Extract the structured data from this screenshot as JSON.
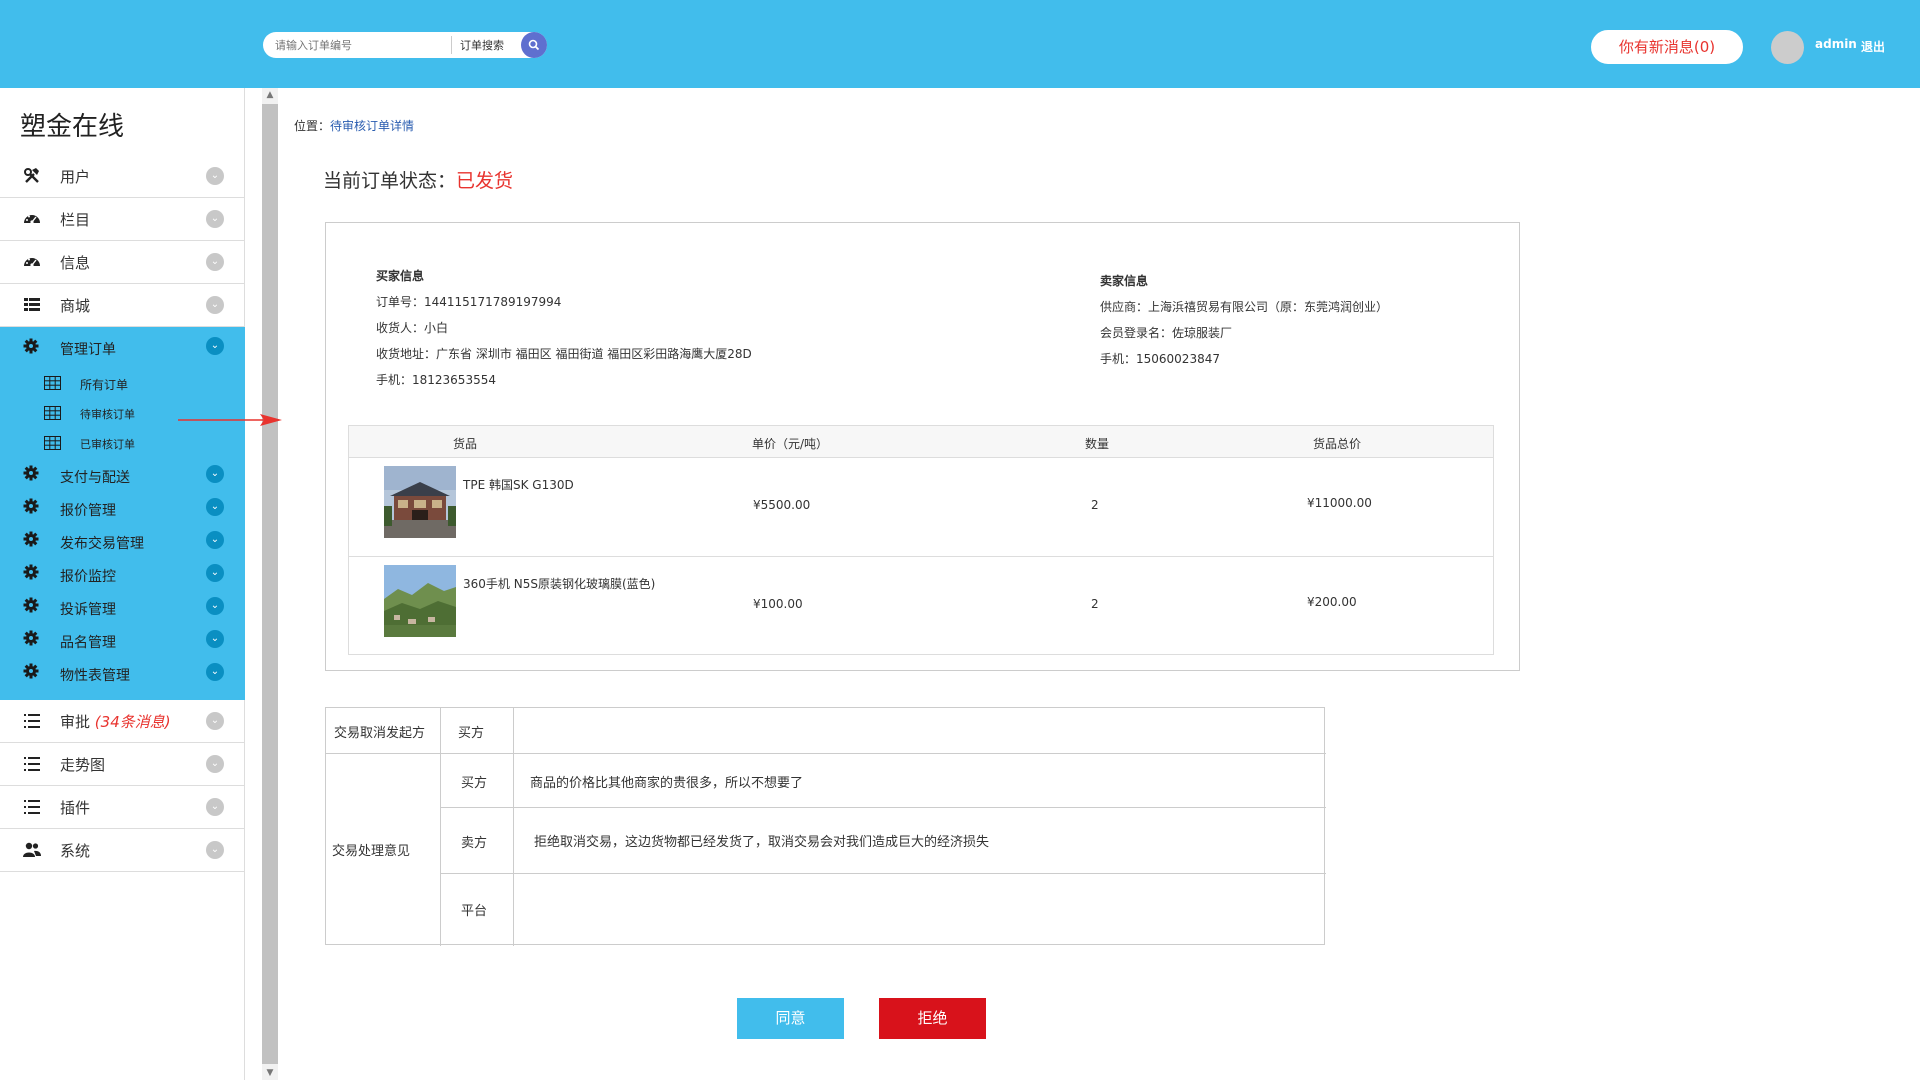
{
  "header": {
    "search_placeholder": "请输入订单编号",
    "search_button": "订单搜索",
    "messages_label": "你有新消息(0)",
    "username": "admin",
    "logout": "退出"
  },
  "sidebar": {
    "brand": "塑金在线",
    "top_items": [
      {
        "label": "用户",
        "icon": "tools-icon"
      },
      {
        "label": "栏目",
        "icon": "dashboard-icon"
      },
      {
        "label": "信息",
        "icon": "dashboard-icon"
      },
      {
        "label": "商城",
        "icon": "list-icon"
      }
    ],
    "active_group": {
      "label": "管理订单",
      "subitems": [
        "所有订单",
        "待审核订单",
        "已审核订单"
      ],
      "items": [
        "支付与配送",
        "报价管理",
        "发布交易管理",
        "报价监控",
        "投诉管理",
        "品名管理",
        "物性表管理"
      ]
    },
    "bottom_items": [
      {
        "label": "审批",
        "note": "(34条消息)"
      },
      {
        "label": "走势图"
      },
      {
        "label": "插件"
      },
      {
        "label": "系统"
      }
    ]
  },
  "breadcrumb": {
    "prefix": "位置：",
    "link": "待审核订单详情"
  },
  "order_status": {
    "label": "当前订单状态：",
    "value": "已发货"
  },
  "buyer": {
    "title": "买家信息",
    "order_no": "订单号：144115171789197994",
    "receiver": "收货人：小白",
    "address": "收货地址：广东省 深圳市 福田区 福田街道 福田区彩田路海鹰大厦28D",
    "phone": "手机：18123653554"
  },
  "seller": {
    "title": "卖家信息",
    "supplier": "供应商：上海浜禧贸易有限公司（原：东莞鸿润创业）",
    "member": "会员登录名：佐琼服装厂",
    "phone": "手机：15060023847"
  },
  "goods_table": {
    "headers": [
      "货品",
      "单价（元/吨）",
      "数量",
      "货品总价"
    ],
    "rows": [
      {
        "name": "TPE 韩国SK G130D",
        "price": "¥5500.00",
        "qty": "2",
        "total": "¥11000.00"
      },
      {
        "name": "360手机 N5S原装钢化玻璃膜(蓝色)",
        "price": "¥100.00",
        "qty": "2",
        "total": "¥200.00"
      }
    ]
  },
  "cancel_table": {
    "initiator_label": "交易取消发起方",
    "initiator_value": "买方",
    "opinion_label": "交易处理意见",
    "rows": [
      {
        "party": "买方",
        "text": "商品的价格比其他商家的贵很多，所以不想要了"
      },
      {
        "party": "卖方",
        "text": "拒绝取消交易，这边货物都已经发货了，取消交易会对我们造成巨大的经济损失"
      },
      {
        "party": "平台",
        "text": ""
      }
    ]
  },
  "actions": {
    "agree": "同意",
    "reject": "拒绝"
  },
  "colors": {
    "header": "#41bdec",
    "accent_red": "#e8332e",
    "reject": "#d8121b"
  }
}
